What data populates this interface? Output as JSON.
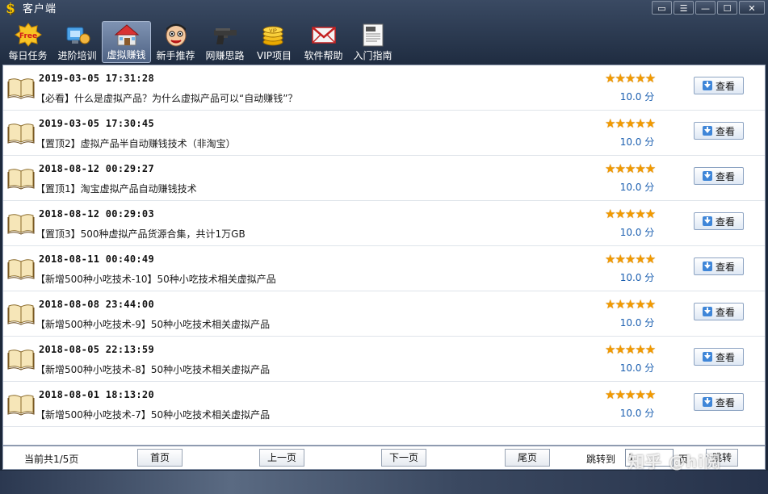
{
  "window": {
    "title": "客户端"
  },
  "toolbar": {
    "items": [
      {
        "label": "每日任务",
        "icon": "free-badge-icon",
        "active": false
      },
      {
        "label": "进阶培训",
        "icon": "training-icon",
        "active": false
      },
      {
        "label": "虚拟赚钱",
        "icon": "house-icon",
        "active": true
      },
      {
        "label": "新手推荐",
        "icon": "cartoon-face-icon",
        "active": false
      },
      {
        "label": "网赚思路",
        "icon": "pistol-icon",
        "active": false
      },
      {
        "label": "VIP项目",
        "icon": "gold-coins-icon",
        "active": false
      },
      {
        "label": "软件帮助",
        "icon": "envelope-icon",
        "active": false
      },
      {
        "label": "入门指南",
        "icon": "newspaper-icon",
        "active": false
      }
    ]
  },
  "list": {
    "view_label": "查看",
    "items": [
      {
        "date": "2019-03-05 17:31:28",
        "title": "【必看】什么是虚拟产品？为什么虚拟产品可以“自动赚钱”？",
        "stars": 5,
        "score": "10.0 分"
      },
      {
        "date": "2019-03-05 17:30:45",
        "title": "【置顶2】虚拟产品半自动赚钱技术（非淘宝）",
        "stars": 5,
        "score": "10.0 分"
      },
      {
        "date": "2018-08-12 00:29:27",
        "title": "【置顶1】淘宝虚拟产品自动赚钱技术",
        "stars": 5,
        "score": "10.0 分"
      },
      {
        "date": "2018-08-12 00:29:03",
        "title": "【置顶3】500种虚拟产品货源合集，共计1万GB",
        "stars": 5,
        "score": "10.0 分"
      },
      {
        "date": "2018-08-11 00:40:49",
        "title": "【新增500种小吃技术-10】50种小吃技术相关虚拟产品",
        "stars": 5,
        "score": "10.0 分"
      },
      {
        "date": "2018-08-08 23:44:00",
        "title": "【新增500种小吃技术-9】50种小吃技术相关虚拟产品",
        "stars": 5,
        "score": "10.0 分"
      },
      {
        "date": "2018-08-05 22:13:59",
        "title": "【新增500种小吃技术-8】50种小吃技术相关虚拟产品",
        "stars": 5,
        "score": "10.0 分"
      },
      {
        "date": "2018-08-01 18:13:20",
        "title": "【新增500种小吃技术-7】50种小吃技术相关虚拟产品",
        "stars": 5,
        "score": "10.0 分"
      }
    ]
  },
  "pager": {
    "info": "当前共1/5页",
    "first": "首页",
    "prev": "上一页",
    "next": "下一页",
    "last": "尾页",
    "jump_label": "跳转到",
    "jump_value": "1",
    "page_unit": "页",
    "go": "跳转"
  },
  "watermark": "知乎 @hi阅",
  "colors": {
    "star": "#f29a00",
    "score": "#1b5fb0",
    "active_tab": "#6a7fa0"
  }
}
